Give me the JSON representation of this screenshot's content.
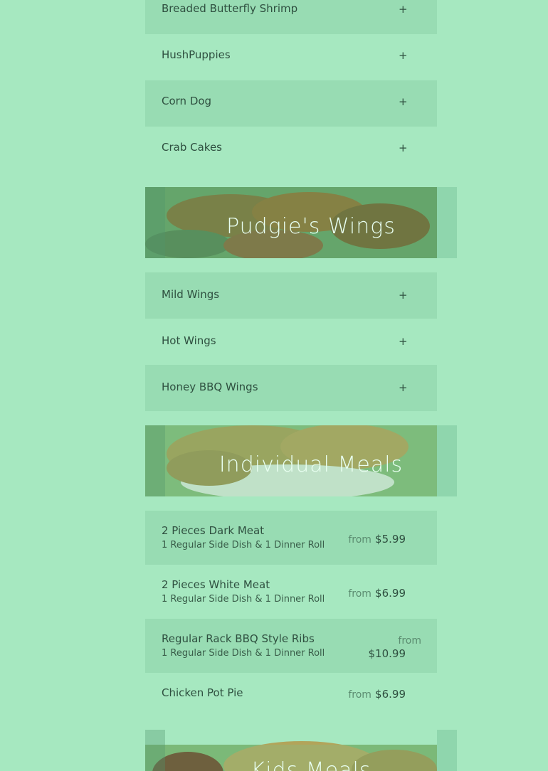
{
  "appetizers": [
    {
      "label": "Breaded Butterfly Shrimp",
      "toggle": "+"
    },
    {
      "label": "HushPuppies",
      "toggle": "+"
    },
    {
      "label": "Corn Dog",
      "toggle": "+"
    },
    {
      "label": "Crab Cakes",
      "toggle": "+"
    }
  ],
  "wings_section": {
    "title": "Pudgie's Wings",
    "items": [
      {
        "label": "Mild Wings",
        "toggle": "+"
      },
      {
        "label": "Hot Wings",
        "toggle": "+"
      },
      {
        "label": "Honey BBQ Wings",
        "toggle": "+"
      }
    ]
  },
  "meals_section": {
    "title": "Individual Meals",
    "items": [
      {
        "name": "2 Pieces Dark Meat",
        "desc": "1 Regular Side Dish & 1 Dinner Roll",
        "from": "from",
        "price": "$5.99"
      },
      {
        "name": "2 Pieces White Meat",
        "desc": "1 Regular Side Dish & 1 Dinner Roll",
        "from": "from",
        "price": "$6.99"
      },
      {
        "name": "Regular Rack BBQ Style Ribs",
        "desc": "1 Regular Side Dish & 1 Dinner Roll",
        "from": "from",
        "price": "$10.99"
      },
      {
        "name": "Chicken Pot Pie",
        "desc": "",
        "from": "from",
        "price": "$6.99"
      }
    ]
  },
  "kids_section": {
    "title": "Kids Meals"
  }
}
